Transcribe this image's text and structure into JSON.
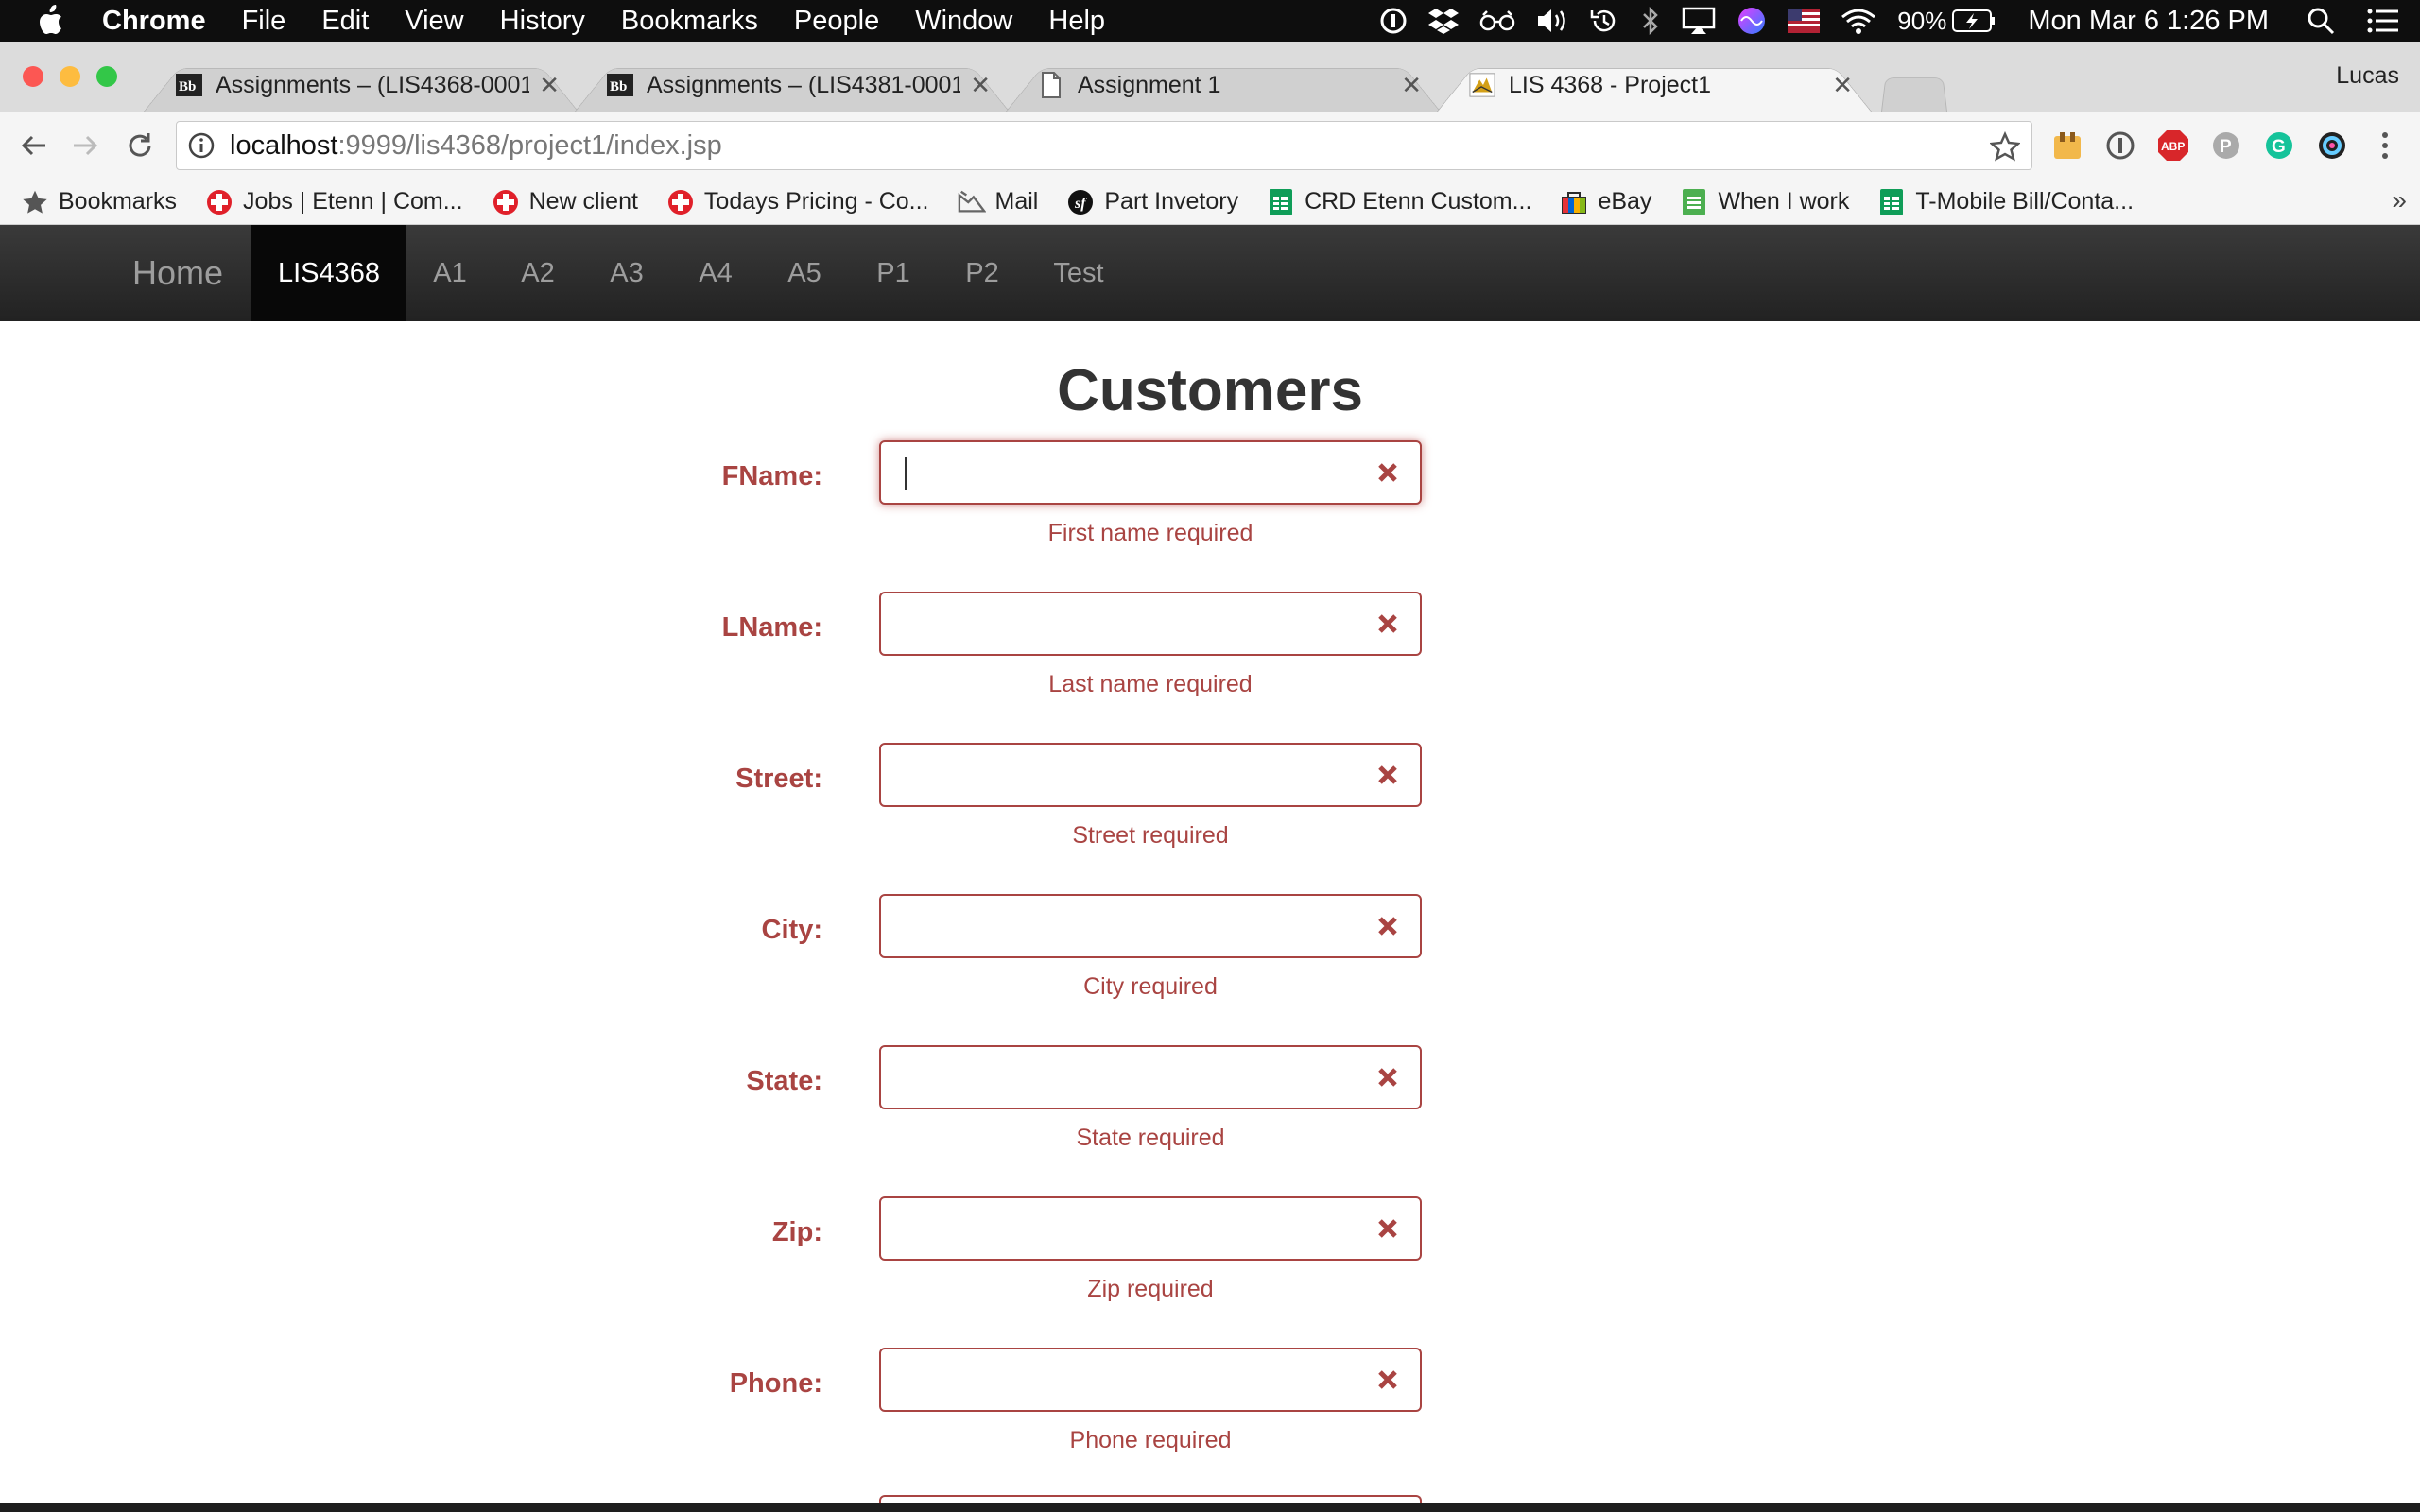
{
  "menubar": {
    "app": "Chrome",
    "items": [
      "File",
      "Edit",
      "View",
      "History",
      "Bookmarks",
      "People",
      "Window",
      "Help"
    ],
    "battery": "90%",
    "clock": "Mon Mar 6  1:26 PM"
  },
  "tabs": [
    {
      "title": "Assignments – (LIS4368-0001",
      "favicon": "blackboard-icon",
      "active": false
    },
    {
      "title": "Assignments – (LIS4381-0001",
      "favicon": "blackboard-icon",
      "active": false
    },
    {
      "title": "Assignment 1",
      "favicon": "document-icon",
      "active": false
    },
    {
      "title": "LIS 4368 - Project1",
      "favicon": "tomcat-icon",
      "active": true
    }
  ],
  "profile": "Lucas",
  "address": {
    "host": "localhost",
    "path": ":9999/lis4368/project1/index.jsp"
  },
  "bookmarks": [
    {
      "label": "Bookmarks",
      "icon": "star-icon"
    },
    {
      "label": "Jobs | Etenn | Com...",
      "icon": "red-cross-icon"
    },
    {
      "label": "New client",
      "icon": "red-cross-icon"
    },
    {
      "label": "Todays Pricing - Co...",
      "icon": "red-cross-icon"
    },
    {
      "label": "Mail",
      "icon": "mail-icon"
    },
    {
      "label": "Part Invetory",
      "icon": "symfony-icon"
    },
    {
      "label": "CRD Etenn Custom...",
      "icon": "sheets-icon"
    },
    {
      "label": "eBay",
      "icon": "ebay-icon"
    },
    {
      "label": "When I work",
      "icon": "forms-icon"
    },
    {
      "label": "T-Mobile Bill/Conta...",
      "icon": "sheets-icon"
    }
  ],
  "sitenav": {
    "brand": "Home",
    "items": [
      "LIS4368",
      "A1",
      "A2",
      "A3",
      "A4",
      "A5",
      "P1",
      "P2",
      "Test"
    ],
    "active": "LIS4368"
  },
  "page": {
    "title": "Customers",
    "fields": [
      {
        "label": "FName:",
        "value": "",
        "help": "First name required"
      },
      {
        "label": "LName:",
        "value": "",
        "help": "Last name required"
      },
      {
        "label": "Street:",
        "value": "",
        "help": "Street required"
      },
      {
        "label": "City:",
        "value": "",
        "help": "City required"
      },
      {
        "label": "State:",
        "value": "",
        "help": "State required"
      },
      {
        "label": "Zip:",
        "value": "",
        "help": "Zip required"
      },
      {
        "label": "Phone:",
        "value": "",
        "help": "Phone required"
      }
    ]
  },
  "colors": {
    "error": "#a94442",
    "navbar": "#222222",
    "active_nav": "#080808"
  }
}
